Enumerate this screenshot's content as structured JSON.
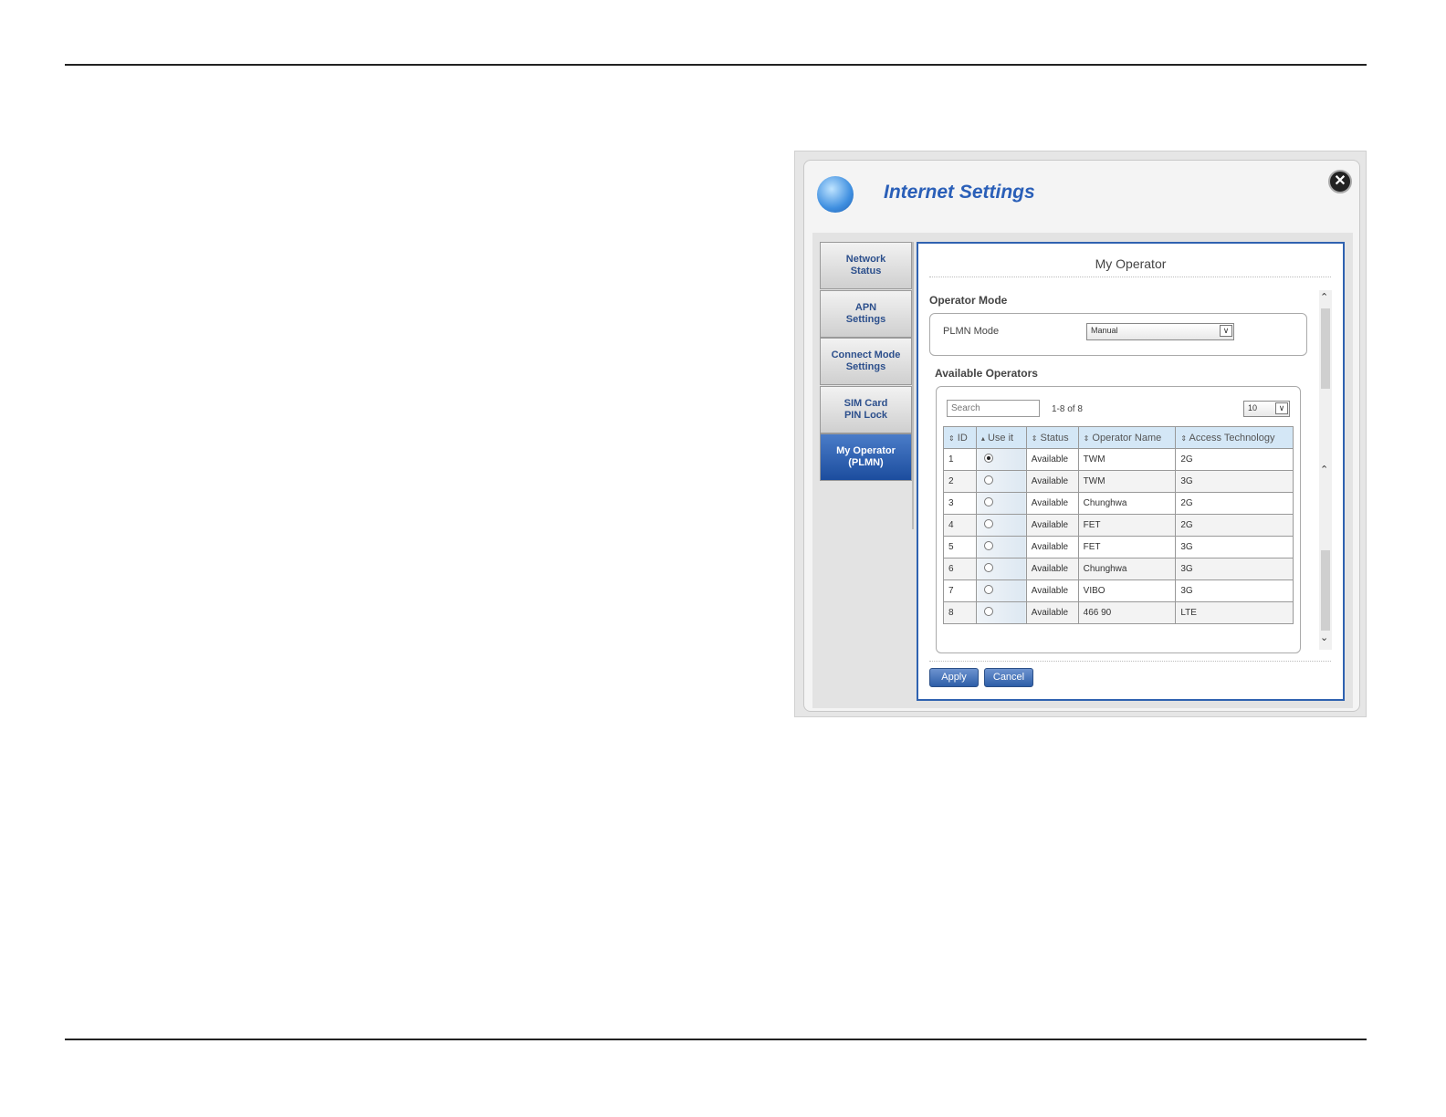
{
  "dialog": {
    "title": "Internet Settings",
    "close_icon": "close-icon"
  },
  "sidebar": {
    "items": [
      {
        "line1": "Network",
        "line2": "Status",
        "active": false
      },
      {
        "line1": "APN",
        "line2": "Settings",
        "active": false
      },
      {
        "line1": "Connect Mode",
        "line2": "Settings",
        "active": false
      },
      {
        "line1": "SIM Card",
        "line2": "PIN Lock",
        "active": false
      },
      {
        "line1": "My Operator",
        "line2": "(PLMN)",
        "active": true
      }
    ]
  },
  "main": {
    "title": "My Operator",
    "operator_mode": {
      "heading": "Operator Mode",
      "plmn_label": "PLMN Mode",
      "plmn_value": "Manual"
    },
    "available": {
      "heading": "Available Operators",
      "search_placeholder": "Search",
      "count": "1-8 of 8",
      "page_size": "10",
      "columns": [
        "ID",
        "Use it",
        "Status",
        "Operator Name",
        "Access Technology"
      ],
      "rows": [
        {
          "id": "1",
          "selected": true,
          "status": "Available",
          "name": "TWM",
          "tech": "2G"
        },
        {
          "id": "2",
          "selected": false,
          "status": "Available",
          "name": "TWM",
          "tech": "3G"
        },
        {
          "id": "3",
          "selected": false,
          "status": "Available",
          "name": "Chunghwa",
          "tech": "2G"
        },
        {
          "id": "4",
          "selected": false,
          "status": "Available",
          "name": "FET",
          "tech": "2G"
        },
        {
          "id": "5",
          "selected": false,
          "status": "Available",
          "name": "FET",
          "tech": "3G"
        },
        {
          "id": "6",
          "selected": false,
          "status": "Available",
          "name": "Chunghwa",
          "tech": "3G"
        },
        {
          "id": "7",
          "selected": false,
          "status": "Available",
          "name": "VIBO",
          "tech": "3G"
        },
        {
          "id": "8",
          "selected": false,
          "status": "Available",
          "name": "466 90",
          "tech": "LTE"
        }
      ]
    },
    "apply_label": "Apply",
    "cancel_label": "Cancel"
  },
  "colors": {
    "accent": "#2a5fb8",
    "active_tab": "#1c4d9e",
    "header_row": "#d4e7f6"
  }
}
